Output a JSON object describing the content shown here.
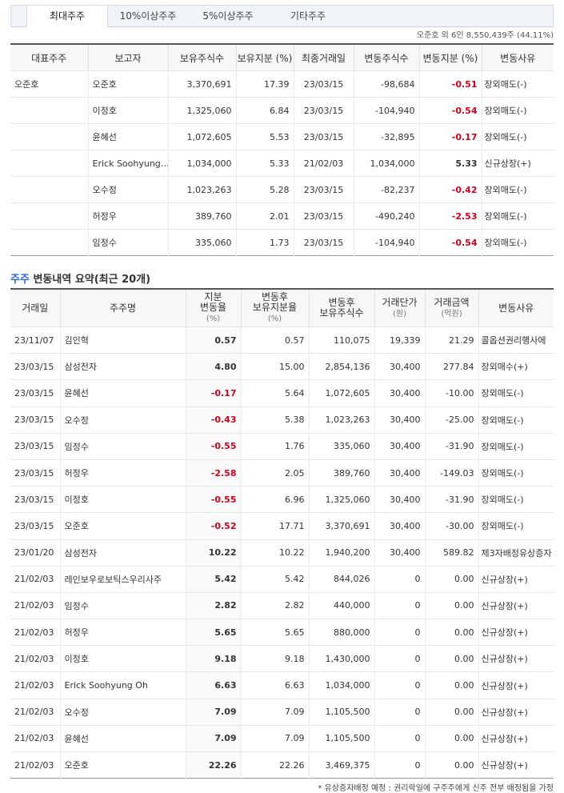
{
  "tabs": [
    "최대주주",
    "10%이상주주",
    "5%이상주주",
    "기타주주"
  ],
  "summary": "오준호 외 6인 8,550,439주 (44.11%)",
  "major": {
    "headers": [
      "대표주주",
      "보고자",
      "보유주식수",
      "보유지분 (%)",
      "최종거래일",
      "변동주식수",
      "변동지분 (%)",
      "변동사유"
    ],
    "rep": "오준호",
    "rows": [
      [
        "오준호",
        "3,370,691",
        "17.39",
        "23/03/15",
        "-98,684",
        "-0.51",
        "장외매도(-)"
      ],
      [
        "이정호",
        "1,325,060",
        "6.84",
        "23/03/15",
        "-104,940",
        "-0.54",
        "장외매도(-)"
      ],
      [
        "윤혜선",
        "1,072,605",
        "5.53",
        "23/03/15",
        "-32,895",
        "-0.17",
        "장외매도(-)"
      ],
      [
        "Erick Soohyung…",
        "1,034,000",
        "5.33",
        "21/02/03",
        "1,034,000",
        "5.33",
        "신규상장(+)"
      ],
      [
        "오수정",
        "1,023,263",
        "5.28",
        "23/03/15",
        "-82,237",
        "-0.42",
        "장외매도(-)"
      ],
      [
        "허정우",
        "389,760",
        "2.01",
        "23/03/15",
        "-490,240",
        "-2.53",
        "장외매도(-)"
      ],
      [
        "임정수",
        "335,060",
        "1.73",
        "23/03/15",
        "-104,940",
        "-0.54",
        "장외매도(-)"
      ]
    ]
  },
  "section": {
    "highlight": "주주",
    "title": " 변동내역 요약(최근 20개)"
  },
  "changes": {
    "headers": [
      {
        "main": "거래일",
        "sub": ""
      },
      {
        "main": "주주명",
        "sub": ""
      },
      {
        "main": "지분\n변동율",
        "sub": "(%)"
      },
      {
        "main": "변동후\n보유지분율",
        "sub": "(%)"
      },
      {
        "main": "변동후\n보유주식수",
        "sub": ""
      },
      {
        "main": "거래단가",
        "sub": "(원)"
      },
      {
        "main": "거래금액",
        "sub": "(억원)"
      },
      {
        "main": "변동사유",
        "sub": ""
      }
    ],
    "rows": [
      [
        "23/11/07",
        "김인혁",
        "0.57",
        "0.57",
        "110,075",
        "19,339",
        "21.29",
        "콜옵션권리행사에"
      ],
      [
        "23/03/15",
        "삼성전자",
        "4.80",
        "15.00",
        "2,854,136",
        "30,400",
        "277.84",
        "장외매수(+)"
      ],
      [
        "23/03/15",
        "윤혜선",
        "-0.17",
        "5.64",
        "1,072,605",
        "30,400",
        "-10.00",
        "장외매도(-)"
      ],
      [
        "23/03/15",
        "오수정",
        "-0.43",
        "5.38",
        "1,023,263",
        "30,400",
        "-25.00",
        "장외매도(-)"
      ],
      [
        "23/03/15",
        "임정수",
        "-0.55",
        "1.76",
        "335,060",
        "30,400",
        "-31.90",
        "장외매도(-)"
      ],
      [
        "23/03/15",
        "허정우",
        "-2.58",
        "2.05",
        "389,760",
        "30,400",
        "-149.03",
        "장외매도(-)"
      ],
      [
        "23/03/15",
        "이정호",
        "-0.55",
        "6.96",
        "1,325,060",
        "30,400",
        "-31.90",
        "장외매도(-)"
      ],
      [
        "23/03/15",
        "오준호",
        "-0.52",
        "17.71",
        "3,370,691",
        "30,400",
        "-30.00",
        "장외매도(-)"
      ],
      [
        "23/01/20",
        "삼성전자",
        "10.22",
        "10.22",
        "1,940,200",
        "30,400",
        "589.82",
        "제3자배정유상증자"
      ],
      [
        "21/02/03",
        "레인보우로보틱스우리사주",
        "5.42",
        "5.42",
        "844,026",
        "0",
        "0.00",
        "신규상장(+)"
      ],
      [
        "21/02/03",
        "임정수",
        "2.82",
        "2.82",
        "440,000",
        "0",
        "0.00",
        "신규상장(+)"
      ],
      [
        "21/02/03",
        "허정우",
        "5.65",
        "5.65",
        "880,000",
        "0",
        "0.00",
        "신규상장(+)"
      ],
      [
        "21/02/03",
        "이정호",
        "9.18",
        "9.18",
        "1,430,000",
        "0",
        "0.00",
        "신규상장(+)"
      ],
      [
        "21/02/03",
        "Erick Soohyung Oh",
        "6.63",
        "6.63",
        "1,034,000",
        "0",
        "0.00",
        "신규상장(+)"
      ],
      [
        "21/02/03",
        "오수정",
        "7.09",
        "7.09",
        "1,105,500",
        "0",
        "0.00",
        "신규상장(+)"
      ],
      [
        "21/02/03",
        "윤혜선",
        "7.09",
        "7.09",
        "1,105,500",
        "0",
        "0.00",
        "신규상장(+)"
      ],
      [
        "21/02/03",
        "오준호",
        "22.26",
        "22.26",
        "3,469,375",
        "0",
        "0.00",
        "신규상장(+)"
      ]
    ]
  },
  "footnote": "* 유상증자배정 예정 : 권리락일에 구주주에게 신주 전부 배정됨을 가정",
  "colors": {
    "negative": "#d0021b",
    "highlight": "#2a66c9"
  }
}
